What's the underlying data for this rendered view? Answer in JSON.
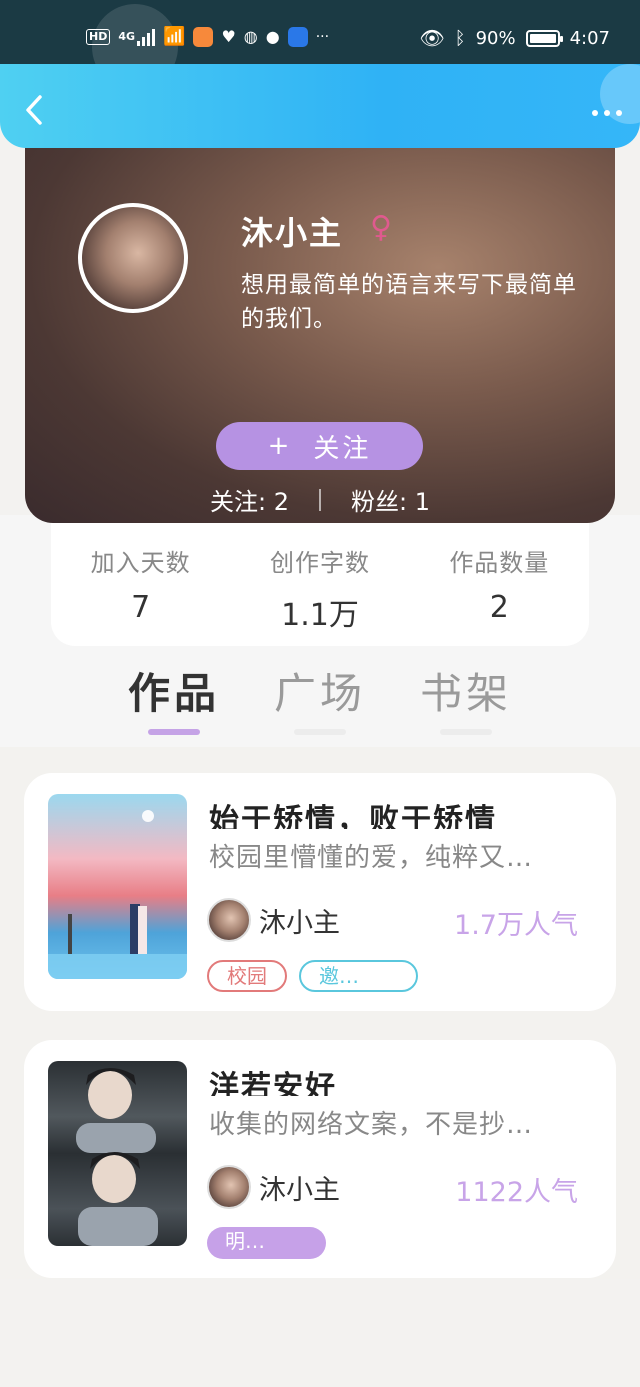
{
  "status_bar": {
    "hd": "HD",
    "network": "4G",
    "battery": "90%",
    "time": "4:07",
    "more": "···"
  },
  "nav": {
    "back_icon": "chevron-left-icon",
    "more_icon": "more-dots-icon"
  },
  "profile": {
    "name": "沐小主",
    "gender_symbol": "♀",
    "bio": "想用最简单的语言来写下最简单的我们。",
    "follow_plus": "+",
    "follow_label": "关注",
    "following": "关注: 2",
    "fans": "粉丝: 1"
  },
  "stats": [
    {
      "label": "加入天数",
      "value": "7"
    },
    {
      "label": "创作字数",
      "value": "1.1万"
    },
    {
      "label": "作品数量",
      "value": "2"
    }
  ],
  "tabs": [
    {
      "label": "作品",
      "active": true
    },
    {
      "label": "广场",
      "active": false
    },
    {
      "label": "书架",
      "active": false
    }
  ],
  "works": [
    {
      "title": "始于矫情，败于矫情",
      "desc": "校园里懵懂的爱，纯粹又…",
      "author": "沐小主",
      "popularity": "1.7万人气",
      "tags": [
        {
          "label": "校园",
          "style": "outline-red"
        },
        {
          "label": "邀…",
          "style": "outline-cyan"
        }
      ]
    },
    {
      "title": "洋若安好",
      "desc": "收集的网络文案，不是抄…",
      "author": "沐小主",
      "popularity": "1122人气",
      "tags": [
        {
          "label": "明…",
          "style": "fill-purple"
        }
      ]
    }
  ],
  "colors": {
    "accent": "#b692e3",
    "nav_gradient_start": "#4fd0f2",
    "nav_gradient_end": "#35b6f8",
    "popularity": "#c8a4e8",
    "tab_active": "#333333",
    "tab_inactive": "#999999"
  }
}
